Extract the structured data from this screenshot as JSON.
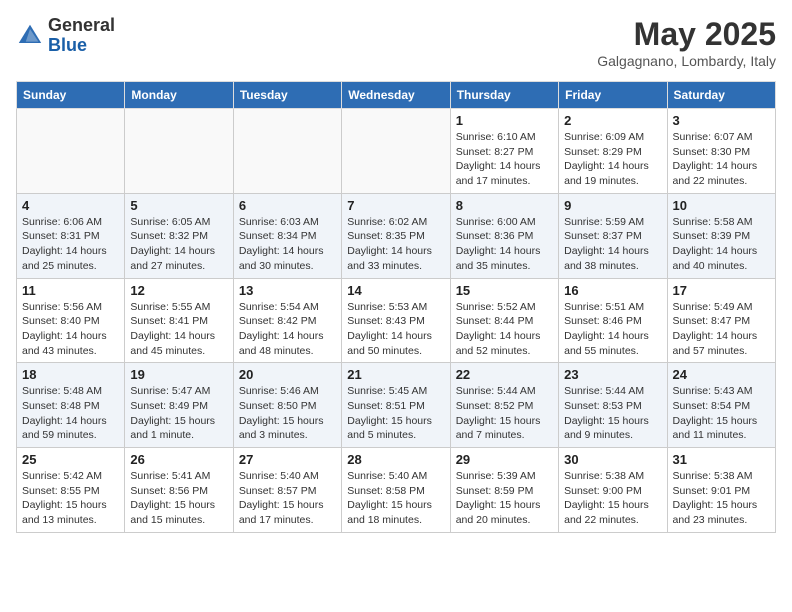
{
  "header": {
    "logo_general": "General",
    "logo_blue": "Blue",
    "month_year": "May 2025",
    "location": "Galgagnano, Lombardy, Italy"
  },
  "days_of_week": [
    "Sunday",
    "Monday",
    "Tuesday",
    "Wednesday",
    "Thursday",
    "Friday",
    "Saturday"
  ],
  "weeks": [
    [
      {
        "day": "",
        "info": ""
      },
      {
        "day": "",
        "info": ""
      },
      {
        "day": "",
        "info": ""
      },
      {
        "day": "",
        "info": ""
      },
      {
        "day": "1",
        "info": "Sunrise: 6:10 AM\nSunset: 8:27 PM\nDaylight: 14 hours and 17 minutes."
      },
      {
        "day": "2",
        "info": "Sunrise: 6:09 AM\nSunset: 8:29 PM\nDaylight: 14 hours and 19 minutes."
      },
      {
        "day": "3",
        "info": "Sunrise: 6:07 AM\nSunset: 8:30 PM\nDaylight: 14 hours and 22 minutes."
      }
    ],
    [
      {
        "day": "4",
        "info": "Sunrise: 6:06 AM\nSunset: 8:31 PM\nDaylight: 14 hours and 25 minutes."
      },
      {
        "day": "5",
        "info": "Sunrise: 6:05 AM\nSunset: 8:32 PM\nDaylight: 14 hours and 27 minutes."
      },
      {
        "day": "6",
        "info": "Sunrise: 6:03 AM\nSunset: 8:34 PM\nDaylight: 14 hours and 30 minutes."
      },
      {
        "day": "7",
        "info": "Sunrise: 6:02 AM\nSunset: 8:35 PM\nDaylight: 14 hours and 33 minutes."
      },
      {
        "day": "8",
        "info": "Sunrise: 6:00 AM\nSunset: 8:36 PM\nDaylight: 14 hours and 35 minutes."
      },
      {
        "day": "9",
        "info": "Sunrise: 5:59 AM\nSunset: 8:37 PM\nDaylight: 14 hours and 38 minutes."
      },
      {
        "day": "10",
        "info": "Sunrise: 5:58 AM\nSunset: 8:39 PM\nDaylight: 14 hours and 40 minutes."
      }
    ],
    [
      {
        "day": "11",
        "info": "Sunrise: 5:56 AM\nSunset: 8:40 PM\nDaylight: 14 hours and 43 minutes."
      },
      {
        "day": "12",
        "info": "Sunrise: 5:55 AM\nSunset: 8:41 PM\nDaylight: 14 hours and 45 minutes."
      },
      {
        "day": "13",
        "info": "Sunrise: 5:54 AM\nSunset: 8:42 PM\nDaylight: 14 hours and 48 minutes."
      },
      {
        "day": "14",
        "info": "Sunrise: 5:53 AM\nSunset: 8:43 PM\nDaylight: 14 hours and 50 minutes."
      },
      {
        "day": "15",
        "info": "Sunrise: 5:52 AM\nSunset: 8:44 PM\nDaylight: 14 hours and 52 minutes."
      },
      {
        "day": "16",
        "info": "Sunrise: 5:51 AM\nSunset: 8:46 PM\nDaylight: 14 hours and 55 minutes."
      },
      {
        "day": "17",
        "info": "Sunrise: 5:49 AM\nSunset: 8:47 PM\nDaylight: 14 hours and 57 minutes."
      }
    ],
    [
      {
        "day": "18",
        "info": "Sunrise: 5:48 AM\nSunset: 8:48 PM\nDaylight: 14 hours and 59 minutes."
      },
      {
        "day": "19",
        "info": "Sunrise: 5:47 AM\nSunset: 8:49 PM\nDaylight: 15 hours and 1 minute."
      },
      {
        "day": "20",
        "info": "Sunrise: 5:46 AM\nSunset: 8:50 PM\nDaylight: 15 hours and 3 minutes."
      },
      {
        "day": "21",
        "info": "Sunrise: 5:45 AM\nSunset: 8:51 PM\nDaylight: 15 hours and 5 minutes."
      },
      {
        "day": "22",
        "info": "Sunrise: 5:44 AM\nSunset: 8:52 PM\nDaylight: 15 hours and 7 minutes."
      },
      {
        "day": "23",
        "info": "Sunrise: 5:44 AM\nSunset: 8:53 PM\nDaylight: 15 hours and 9 minutes."
      },
      {
        "day": "24",
        "info": "Sunrise: 5:43 AM\nSunset: 8:54 PM\nDaylight: 15 hours and 11 minutes."
      }
    ],
    [
      {
        "day": "25",
        "info": "Sunrise: 5:42 AM\nSunset: 8:55 PM\nDaylight: 15 hours and 13 minutes."
      },
      {
        "day": "26",
        "info": "Sunrise: 5:41 AM\nSunset: 8:56 PM\nDaylight: 15 hours and 15 minutes."
      },
      {
        "day": "27",
        "info": "Sunrise: 5:40 AM\nSunset: 8:57 PM\nDaylight: 15 hours and 17 minutes."
      },
      {
        "day": "28",
        "info": "Sunrise: 5:40 AM\nSunset: 8:58 PM\nDaylight: 15 hours and 18 minutes."
      },
      {
        "day": "29",
        "info": "Sunrise: 5:39 AM\nSunset: 8:59 PM\nDaylight: 15 hours and 20 minutes."
      },
      {
        "day": "30",
        "info": "Sunrise: 5:38 AM\nSunset: 9:00 PM\nDaylight: 15 hours and 22 minutes."
      },
      {
        "day": "31",
        "info": "Sunrise: 5:38 AM\nSunset: 9:01 PM\nDaylight: 15 hours and 23 minutes."
      }
    ]
  ]
}
